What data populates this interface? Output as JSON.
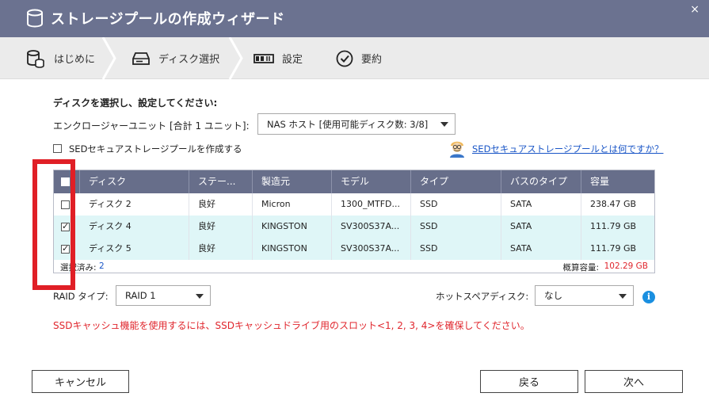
{
  "window": {
    "title": "ストレージプールの作成ウィザード",
    "close_glyph": "×"
  },
  "steps": [
    {
      "label": "はじめに",
      "icon": "database-icon"
    },
    {
      "label": "ディスク選択",
      "icon": "drive-icon"
    },
    {
      "label": "設定",
      "icon": "settings-icon"
    },
    {
      "label": "要約",
      "icon": "check-circle-icon"
    }
  ],
  "main": {
    "instruction": "ディスクを選択し、設定してください:",
    "enclosure_label": "エンクロージャーユニット [合計 1 ユニット]:",
    "enclosure_value": "NAS ホスト [使用可能ディスク数: 3/8]",
    "sed_label": "SEDセキュアストレージプールを作成する",
    "sed_checked": false,
    "sed_link": "SEDセキュアストレージプールとは何ですか？"
  },
  "table": {
    "columns": [
      "ディスク",
      "ステー...",
      "製造元",
      "モデル",
      "タイプ",
      "バスのタイプ",
      "容量"
    ],
    "rows": [
      {
        "checked": false,
        "cells": [
          "ディスク 2",
          "良好",
          "Micron",
          "1300_MTFD...",
          "SSD",
          "SATA",
          "238.47 GB"
        ]
      },
      {
        "checked": true,
        "cells": [
          "ディスク 4",
          "良好",
          "KINGSTON",
          "SV300S37A...",
          "SSD",
          "SATA",
          "111.79 GB"
        ]
      },
      {
        "checked": true,
        "cells": [
          "ディスク 5",
          "良好",
          "KINGSTON",
          "SV300S37A...",
          "SSD",
          "SATA",
          "111.79 GB"
        ]
      }
    ],
    "selected_label": "選択済み:",
    "selected_count": "2",
    "capacity_label": "概算容量:",
    "capacity_value": "102.29 GB"
  },
  "raid": {
    "label": "RAID タイプ:",
    "value": "RAID 1",
    "spare_label": "ホットスペアディスク:",
    "spare_value": "なし"
  },
  "warning": "SSDキャッシュ機能を使用するには、SSDキャッシュドライブ用のスロット<1, 2, 3, 4>を確保してください。",
  "buttons": {
    "cancel": "キャンセル",
    "back": "戻る",
    "next": "次へ"
  },
  "colors": {
    "titlebar": "#6b7290",
    "table_header": "#676e8a",
    "selected_row": "#dff6f7",
    "highlight": "#e01f26",
    "warning": "#e0262d",
    "link": "#1a56c7"
  }
}
